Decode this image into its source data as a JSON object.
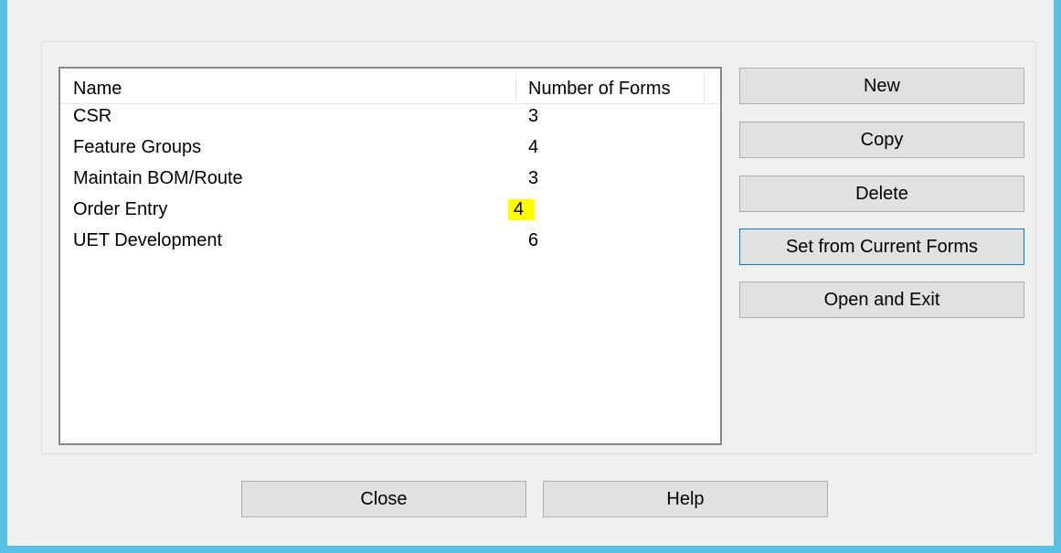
{
  "list": {
    "columns": [
      "Name",
      "Number of Forms"
    ],
    "rows": [
      {
        "name": "CSR",
        "count": "3"
      },
      {
        "name": "Feature Groups",
        "count": "4"
      },
      {
        "name": "Maintain BOM/Route",
        "count": "3"
      },
      {
        "name": "Order Entry",
        "count": "4"
      },
      {
        "name": "UET Development",
        "count": "6"
      }
    ],
    "highlight_color": "#ffff00"
  },
  "buttons": {
    "new_label": "New",
    "copy_label": "Copy",
    "delete_label": "Delete",
    "set_current_label": "Set from Current Forms",
    "open_exit_label": "Open and Exit",
    "close_label": "Close",
    "help_label": "Help"
  },
  "colors": {
    "window_border": "#5bc0e6",
    "dialog_bg": "#f0f0f0",
    "button_bg": "#e1e1e1",
    "focus_border": "#0078d7"
  }
}
